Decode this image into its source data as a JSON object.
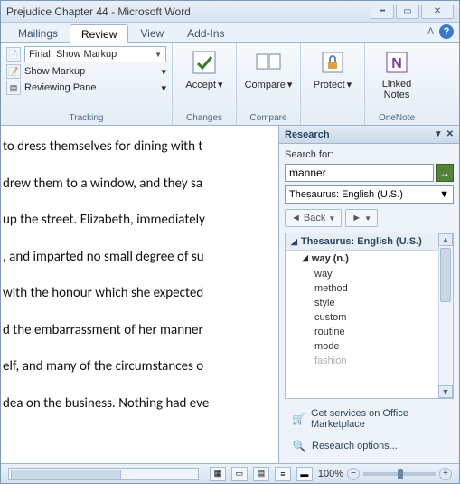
{
  "window": {
    "title": "Prejudice Chapter 44  -  Microsoft Word"
  },
  "tabs": {
    "items": [
      "Mailings",
      "Review",
      "View",
      "Add-Ins"
    ],
    "active": "Review"
  },
  "ribbon": {
    "tracking": {
      "display_dd": "Final: Show Markup",
      "show_markup": "Show Markup",
      "reviewing_pane": "Reviewing Pane",
      "label": "Tracking"
    },
    "changes": {
      "accept": "Accept",
      "label": "Changes"
    },
    "compare": {
      "btn": "Compare",
      "label": "Compare"
    },
    "protect": {
      "btn": "Protect",
      "label": ""
    },
    "onenote": {
      "btn": "Linked Notes",
      "label": "OneNote"
    }
  },
  "document": {
    "lines": [
      "to dress themselves for dining with t",
      "drew them to a window, and they sa",
      "up the street. Elizabeth, immediately",
      ", and imparted no small degree of su",
      "with the honour which she expected",
      "d the embarrassment of her manner",
      "elf, and many of the circumstances o",
      "dea on the business. Nothing had eve"
    ]
  },
  "research": {
    "title": "Research",
    "search_label": "Search for:",
    "search_value": "manner",
    "source": "Thesaurus: English (U.S.)",
    "back": "Back",
    "results_header": "Thesaurus: English (U.S.)",
    "word_header": "way (n.)",
    "synonyms": [
      "way",
      "method",
      "style",
      "custom",
      "routine",
      "mode",
      "fashion"
    ],
    "marketplace": "Get services on Office Marketplace",
    "options": "Research options..."
  },
  "status": {
    "zoom_pct": "100%"
  }
}
